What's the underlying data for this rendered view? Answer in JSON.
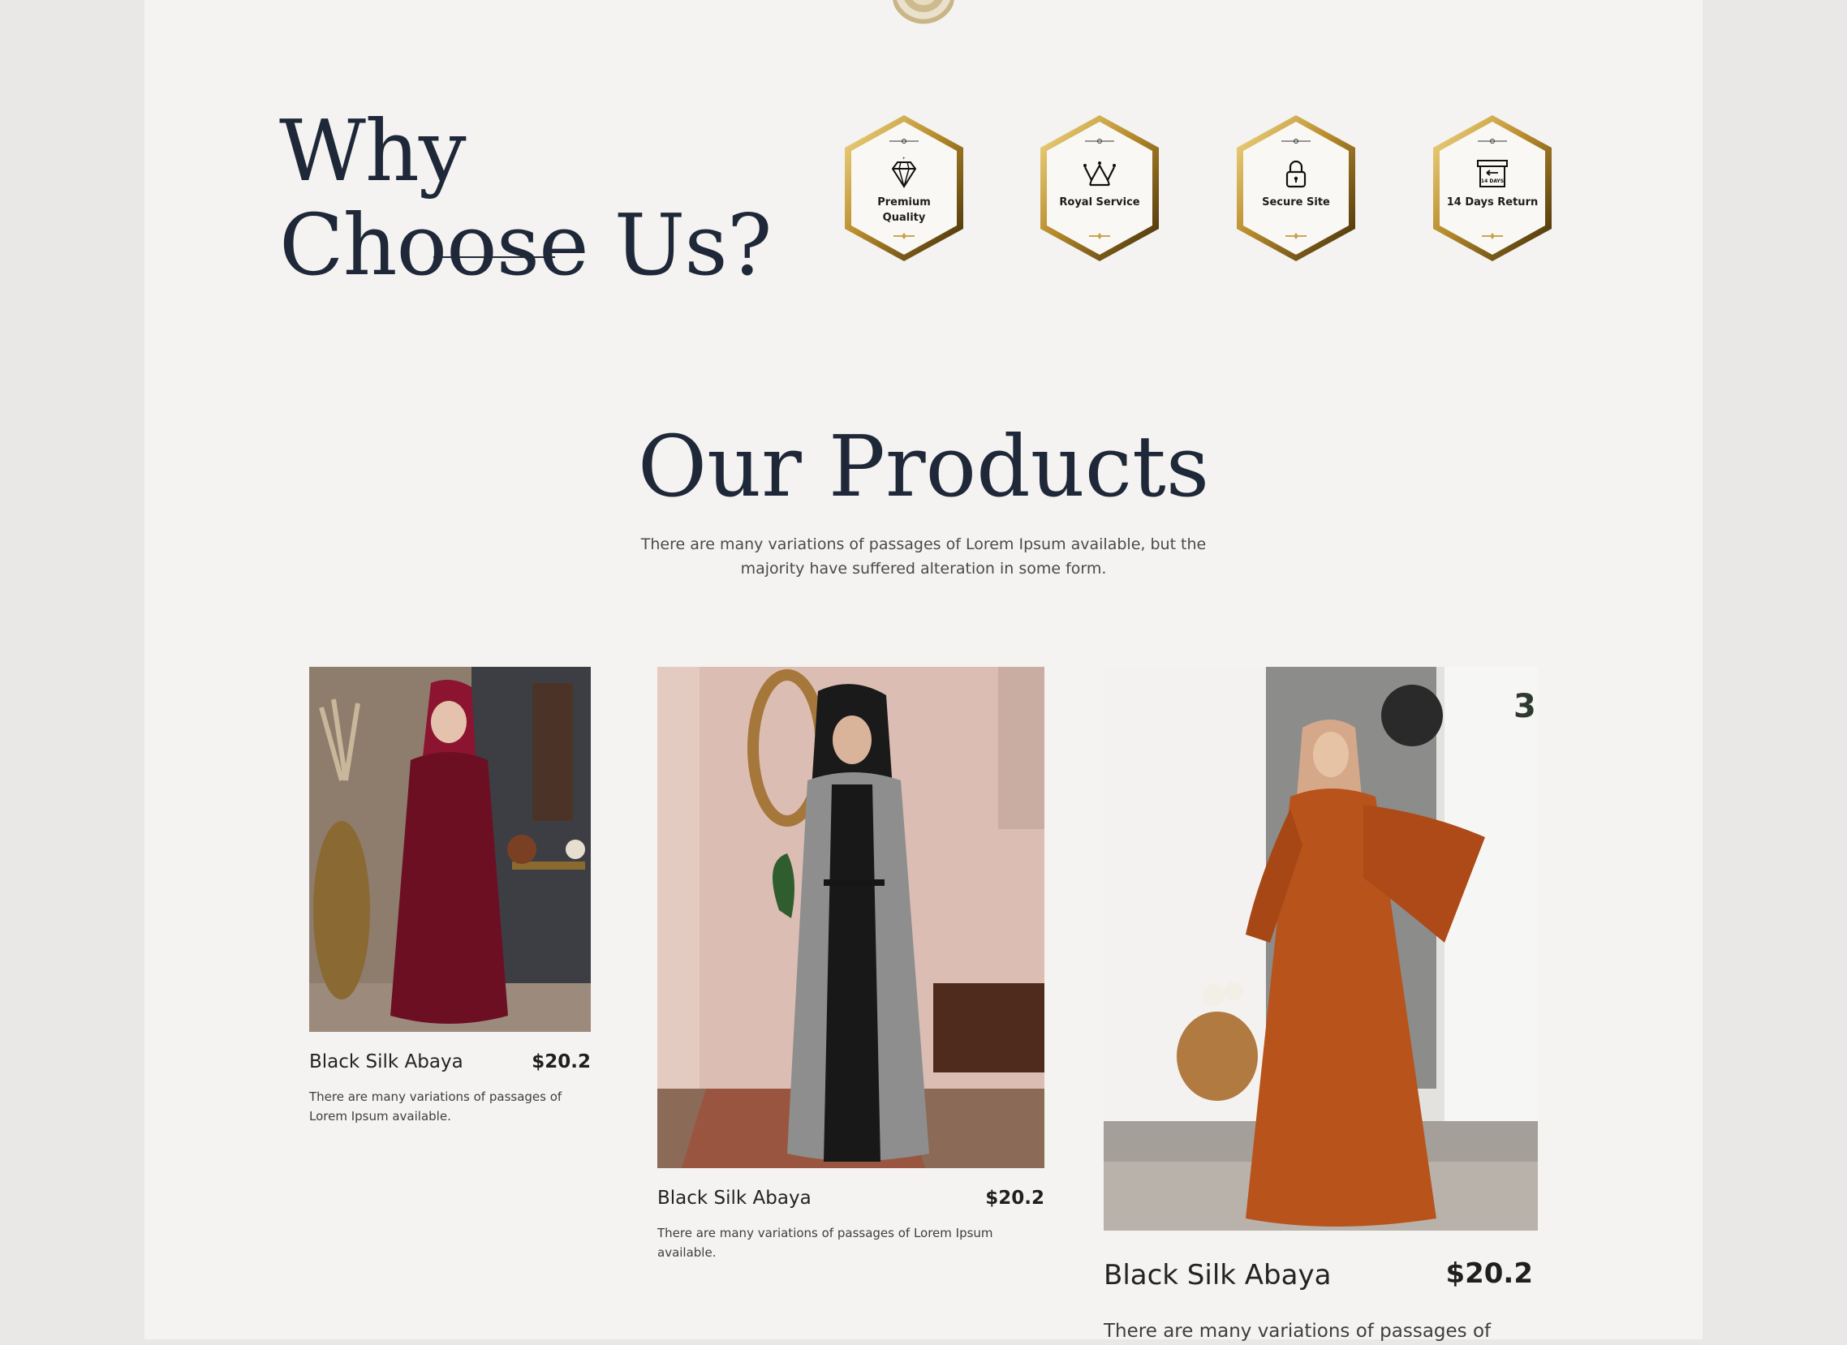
{
  "why": {
    "title": "Why Choose Us?",
    "badges": [
      {
        "label": "Premium Quality",
        "icon": "diamond-icon"
      },
      {
        "label": "Royal Service",
        "icon": "crown-icon"
      },
      {
        "label": "Secure Site",
        "icon": "lock-icon"
      },
      {
        "label": "14 Days Return",
        "icon": "return-box-icon",
        "icon_text": "14 DAYS"
      }
    ]
  },
  "products": {
    "title": "Our Products",
    "subtitle": "There are many variations of passages of Lorem Ipsum available, but the majority have suffered alteration in some form.",
    "items": [
      {
        "name": "Black Silk Abaya",
        "price": "$20.2",
        "description": "There are many variations of passages of Lorem Ipsum available."
      },
      {
        "name": "Black Silk Abaya",
        "price": "$20.2",
        "description": "There are many variations of passages of Lorem Ipsum available."
      },
      {
        "name": "Black Silk Abaya",
        "price": "$20.2",
        "description": "There are many variations of passages of"
      }
    ]
  },
  "colors": {
    "page_background": "#f4f3f1",
    "heading": "#1f2838",
    "gold": "#c9a24a",
    "gold_dark": "#6b4d12"
  }
}
